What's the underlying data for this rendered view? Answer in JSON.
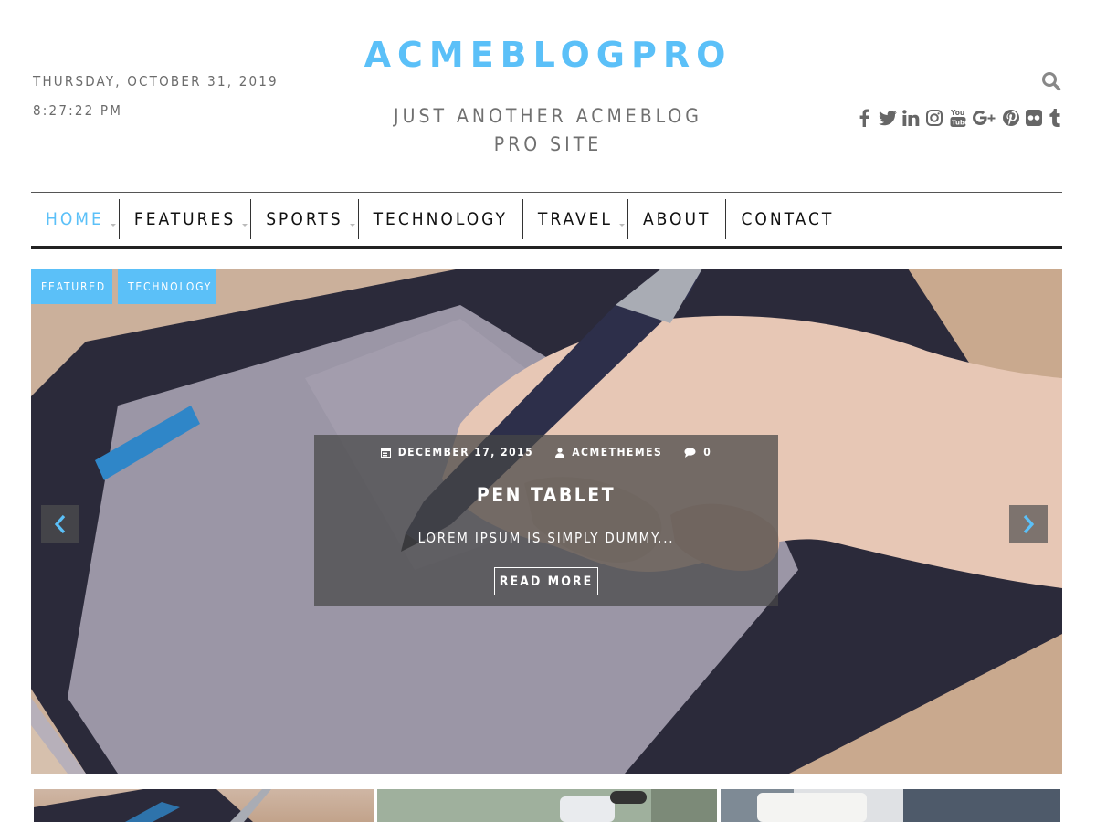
{
  "header": {
    "date": "THURSDAY, OCTOBER 31, 2019",
    "time": "8:27:22 PM",
    "site_title": "ACMEBLOGPRO",
    "tagline": "JUST ANOTHER ACMEBLOG PRO SITE",
    "search_icon": "search-icon",
    "social_icons": [
      "facebook-icon",
      "twitter-icon",
      "linkedin-icon",
      "instagram-icon",
      "youtube-icon",
      "google-plus-icon",
      "pinterest-icon",
      "flickr-icon",
      "tumblr-icon"
    ]
  },
  "nav": {
    "items": [
      {
        "label": "HOME",
        "active": true,
        "has_submenu": true
      },
      {
        "label": "FEATURES",
        "active": false,
        "has_submenu": true
      },
      {
        "label": "SPORTS",
        "active": false,
        "has_submenu": true
      },
      {
        "label": "TECHNOLOGY",
        "active": false,
        "has_submenu": false
      },
      {
        "label": "TRAVEL",
        "active": false,
        "has_submenu": true
      },
      {
        "label": "ABOUT",
        "active": false,
        "has_submenu": false
      },
      {
        "label": "CONTACT",
        "active": false,
        "has_submenu": false
      }
    ]
  },
  "slider": {
    "tags": [
      "FEATURED",
      "TECHNOLOGY"
    ],
    "meta": {
      "date": "DECEMBER 17, 2015",
      "author": "ACMETHEMES",
      "comments": "0"
    },
    "title": "PEN TABLET",
    "excerpt": "LOREM IPSUM IS SIMPLY DUMMY...",
    "read_more_label": "READ MORE",
    "prev_icon": "chevron-left-icon",
    "next_icon": "chevron-right-icon"
  },
  "colors": {
    "accent": "#5bc0f8",
    "text_muted": "#6b6b6b",
    "nav_text": "#111111",
    "nav_border": "#222222",
    "caption_bg": "#464646"
  }
}
